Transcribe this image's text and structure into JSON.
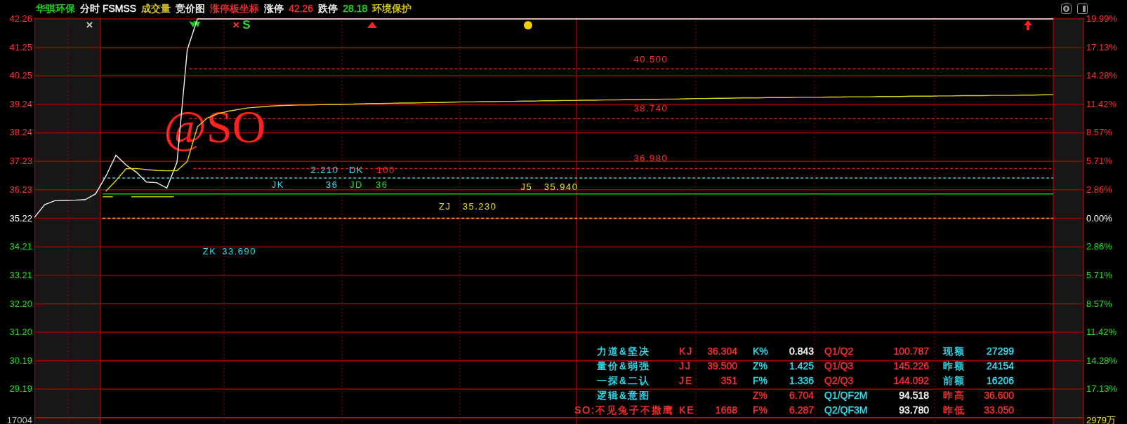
{
  "header": {
    "items": [
      {
        "text": "华骐环保",
        "color": "#20e020"
      },
      {
        "text": "分时 FSMSS",
        "color": "#ffffff"
      },
      {
        "text": "成交量",
        "color": "#e0d020"
      },
      {
        "text": "竞价图",
        "color": "#ffffff"
      },
      {
        "text": "涨停板坐标",
        "color": "#ff3030"
      },
      {
        "text": "涨停",
        "color": "#ffffff"
      },
      {
        "text": "42.26",
        "color": "#ff3030"
      },
      {
        "text": "跌停",
        "color": "#ffffff"
      },
      {
        "text": "28.18",
        "color": "#20e020"
      },
      {
        "text": "环境保护",
        "color": "#e0d020"
      }
    ]
  },
  "chart": {
    "chart_data": {
      "type": "line",
      "ylim": [
        28.18,
        42.26
      ],
      "grid": true,
      "ref_lines": [
        {
          "axis": "y",
          "value": 40.5,
          "color": "#d02020"
        },
        {
          "axis": "y",
          "value": 38.74,
          "color": "#d02020"
        },
        {
          "axis": "y",
          "value": 36.98,
          "color": "#d02020"
        },
        {
          "axis": "y",
          "value": 36.64,
          "color": "#30d0e0"
        },
        {
          "axis": "y",
          "value": 36.08,
          "color": "#20c020"
        },
        {
          "axis": "y",
          "value": 35.22,
          "color": "#ffb000"
        }
      ],
      "categories": [
        null,
        null,
        null,
        null,
        null,
        null,
        null,
        null,
        null,
        null,
        null,
        null,
        null,
        null,
        null,
        null,
        null,
        null,
        null,
        null,
        null,
        null,
        null,
        null,
        null,
        null,
        null,
        null,
        null,
        null,
        null,
        null,
        null,
        null,
        null,
        null,
        null,
        null,
        null,
        null,
        null,
        null,
        null,
        null,
        null,
        null,
        null,
        null,
        null,
        null,
        null,
        null,
        null,
        null,
        null,
        null,
        null,
        null,
        null,
        null,
        null,
        null,
        null,
        null,
        null,
        null,
        null,
        null,
        null,
        null,
        null,
        null,
        null,
        null,
        null,
        null,
        null,
        null,
        null,
        null,
        null,
        null,
        null,
        null,
        null,
        null,
        null,
        null,
        null,
        null,
        null,
        null,
        null,
        null,
        null,
        null,
        null,
        null,
        null,
        null,
        null
      ],
      "series": [
        {
          "color": "#f0f0f0",
          "values": [
            35.25,
            35.7,
            35.84,
            35.85,
            35.86,
            35.88,
            36.08,
            36.7,
            37.45,
            37.1,
            36.85,
            36.5,
            36.48,
            36.29,
            37.2,
            41.17,
            42.26,
            42.26,
            42.26,
            42.26,
            42.26,
            42.26,
            42.26,
            42.26,
            42.26,
            42.26,
            42.26,
            42.26,
            42.26,
            42.26,
            42.26,
            42.26,
            42.26,
            42.26,
            42.26,
            42.26,
            42.26,
            42.26,
            42.26,
            42.26,
            42.26,
            42.26,
            42.26,
            42.26,
            42.26,
            42.26,
            42.26,
            42.26,
            42.26,
            42.26,
            42.26,
            42.26,
            42.26,
            42.26,
            42.26,
            42.26,
            42.26,
            42.26,
            42.26,
            42.26,
            42.26,
            42.26,
            42.26,
            42.26,
            42.26,
            42.26,
            42.26,
            42.26,
            42.26,
            42.26,
            42.26,
            42.26,
            42.26,
            42.26,
            42.26,
            42.26,
            42.26,
            42.26,
            42.26,
            42.26,
            42.26,
            42.26,
            42.26,
            42.26,
            42.26,
            42.26,
            42.26,
            42.26,
            42.26,
            42.26,
            42.26,
            42.26,
            42.26,
            42.26,
            42.26,
            42.26,
            42.26,
            42.26,
            42.26,
            42.26,
            42.26
          ]
        },
        {
          "color": "#e0d020",
          "values": [
            null,
            null,
            null,
            null,
            null,
            null,
            null,
            36.17,
            36.55,
            36.97,
            36.98,
            36.94,
            36.91,
            36.9,
            36.9,
            37.23,
            38.45,
            38.77,
            38.91,
            39.0,
            39.06,
            39.12,
            39.15,
            39.18,
            39.2,
            39.21,
            39.22,
            39.22,
            39.23,
            39.24,
            39.24,
            39.25,
            39.26,
            39.27,
            39.27,
            39.28,
            39.29,
            39.29,
            39.3,
            39.31,
            39.31,
            39.32,
            39.33,
            39.33,
            39.34,
            39.34,
            39.35,
            39.35,
            39.36,
            39.36,
            39.37,
            39.37,
            39.38,
            39.38,
            39.39,
            39.39,
            39.4,
            39.4,
            39.41,
            39.41,
            39.42,
            39.42,
            39.43,
            39.43,
            39.44,
            39.45,
            39.45,
            39.46,
            39.46,
            39.47,
            39.47,
            39.47,
            39.48,
            39.48,
            39.48,
            39.49,
            39.49,
            39.49,
            39.5,
            39.5,
            39.51,
            39.51,
            39.51,
            39.52,
            39.52,
            39.52,
            39.53,
            39.53,
            39.53,
            39.54,
            39.54,
            39.55,
            39.55,
            39.55,
            39.56,
            39.56,
            39.56,
            39.57,
            39.57,
            39.58,
            39.59
          ]
        }
      ],
      "yticks": [
        {
          "value": 42.26,
          "label": "42.26"
        },
        {
          "value": 41.25,
          "label": "41.25"
        },
        {
          "value": 40.25,
          "label": "40.25"
        },
        {
          "value": 39.24,
          "label": "39.24"
        },
        {
          "value": 38.24,
          "label": "38.24"
        },
        {
          "value": 37.23,
          "label": "37.23"
        },
        {
          "value": 36.23,
          "label": "36.23"
        },
        {
          "value": 35.22,
          "label": "35.22"
        },
        {
          "value": 34.21,
          "label": "34.21"
        },
        {
          "value": 33.21,
          "label": "33.21"
        },
        {
          "value": 32.2,
          "label": "32.20"
        },
        {
          "value": 31.2,
          "label": "31.20"
        },
        {
          "value": 30.19,
          "label": "30.19"
        },
        {
          "value": 29.19,
          "label": "29.19"
        }
      ]
    },
    "chart_labels": [
      {
        "text": "×",
        "color": "#c8c8c8",
        "kind": "mark"
      },
      {
        "text": "×",
        "color": "#ff3030",
        "kind": "mark"
      },
      {
        "text": "S",
        "color": "#20e020",
        "kind": "mark"
      },
      {
        "text": "40.500",
        "color": "#ff3030",
        "kind": "small"
      },
      {
        "text": "38.740",
        "color": "#ff3030",
        "kind": "small"
      },
      {
        "text": "@SO",
        "color": "#ff2020",
        "kind": "large"
      },
      {
        "text": "36.980",
        "color": "#ff3030",
        "kind": "small"
      },
      {
        "text": "2.210",
        "color": "#30e0f0",
        "kind": "small"
      },
      {
        "text": "DK",
        "color": "#30e0f0",
        "kind": "small"
      },
      {
        "text": "100",
        "color": "#ff3030",
        "kind": "small"
      },
      {
        "text": "JK",
        "color": "#30e0f0",
        "kind": "small"
      },
      {
        "text": "36",
        "color": "#30e0f0",
        "kind": "small"
      },
      {
        "text": "JD",
        "color": "#20e020",
        "kind": "small"
      },
      {
        "text": "36",
        "color": "#20e020",
        "kind": "small"
      },
      {
        "text": "J5",
        "color": "#f0e020",
        "kind": "small"
      },
      {
        "text": "35.940",
        "color": "#f0e020",
        "kind": "small"
      },
      {
        "text": "ZJ",
        "color": "#f0e020",
        "kind": "small"
      },
      {
        "text": "35.230",
        "color": "#f0e020",
        "kind": "small"
      },
      {
        "text": "ZK",
        "color": "#30e0f0",
        "kind": "small"
      },
      {
        "text": "33.690",
        "color": "#30e0f0",
        "kind": "small"
      }
    ],
    "right_axis": [
      {
        "text": "19.99%",
        "color": "#ff3030"
      },
      {
        "text": "17.13%",
        "color": "#ff3030"
      },
      {
        "text": "14.28%",
        "color": "#ff3030"
      },
      {
        "text": "11.42%",
        "color": "#ff3030"
      },
      {
        "text": "8.57%",
        "color": "#ff3030"
      },
      {
        "text": "5.71%",
        "color": "#ff3030"
      },
      {
        "text": "2.86%",
        "color": "#ff3030"
      },
      {
        "text": "0.00%",
        "color": "#ffffff"
      },
      {
        "text": "2.86%",
        "color": "#20e020"
      },
      {
        "text": "5.71%",
        "color": "#20e020"
      },
      {
        "text": "8.57%",
        "color": "#20e020"
      },
      {
        "text": "11.42%",
        "color": "#20e020"
      },
      {
        "text": "14.28%",
        "color": "#20e020"
      },
      {
        "text": "17.13%",
        "color": "#20e020"
      }
    ],
    "volume_labels": {
      "left": {
        "text": "17004",
        "color": "#c0c0c0"
      },
      "right": {
        "text": "2979万",
        "color": "#f0e020"
      }
    },
    "indicator_table": {
      "rows": [
        {
          "cells": [
            {
              "text": "力道&坚决",
              "color": "#30e0f0"
            },
            {
              "text": "KJ",
              "color": "#ff3030"
            },
            {
              "text": "36.304",
              "color": "#ff3030"
            },
            {
              "text": "K%",
              "color": "#30e0f0"
            },
            {
              "text": "0.843",
              "color": "#ffffff"
            },
            {
              "text": "Q1/Q2",
              "color": "#ff3030"
            },
            {
              "text": "100.787",
              "color": "#ff3030"
            },
            {
              "text": "现额",
              "color": "#30e0f0"
            },
            {
              "text": "27299",
              "color": "#30e0f0"
            }
          ]
        },
        {
          "cells": [
            {
              "text": "量价&弱强",
              "color": "#30e0f0"
            },
            {
              "text": "JJ",
              "color": "#ff3030"
            },
            {
              "text": "39.500",
              "color": "#ff3030"
            },
            {
              "text": "Z%",
              "color": "#30e0f0"
            },
            {
              "text": "1.425",
              "color": "#30e0f0"
            },
            {
              "text": "Q1/Q3",
              "color": "#ff3030"
            },
            {
              "text": "145.226",
              "color": "#ff3030"
            },
            {
              "text": "昨额",
              "color": "#30e0f0"
            },
            {
              "text": "24154",
              "color": "#30e0f0"
            }
          ]
        },
        {
          "cells": [
            {
              "text": "一探&二认",
              "color": "#30e0f0"
            },
            {
              "text": "JE",
              "color": "#ff3030"
            },
            {
              "text": "351",
              "color": "#ff3030"
            },
            {
              "text": "F%",
              "color": "#30e0f0"
            },
            {
              "text": "1.336",
              "color": "#30e0f0"
            },
            {
              "text": "Q2/Q3",
              "color": "#ff3030"
            },
            {
              "text": "144.092",
              "color": "#ff3030"
            },
            {
              "text": "前额",
              "color": "#30e0f0"
            },
            {
              "text": "16206",
              "color": "#30e0f0"
            }
          ]
        },
        {
          "cells": [
            {
              "text": "逻辑&意图",
              "color": "#30e0f0"
            },
            null,
            null,
            {
              "text": "Z%",
              "color": "#ff3030"
            },
            {
              "text": "6.704",
              "color": "#ff3030"
            },
            {
              "text": "Q1/QF2M",
              "color": "#30e0f0"
            },
            {
              "text": "94.518",
              "color": "#ffffff"
            },
            {
              "text": "昨高",
              "color": "#ff3030"
            },
            {
              "text": "36.600",
              "color": "#ff3030"
            }
          ]
        },
        {
          "cells": [
            {
              "text": "SO:不见兔子不撒鹰",
              "color": "#ff3030"
            },
            {
              "text": "KE",
              "color": "#ff3030"
            },
            {
              "text": "1668",
              "color": "#ff3030"
            },
            {
              "text": "F%",
              "color": "#ff3030"
            },
            {
              "text": "6.287",
              "color": "#ff3030"
            },
            {
              "text": "Q2/QF3M",
              "color": "#30e0f0"
            },
            {
              "text": "93.780",
              "color": "#ffffff"
            },
            {
              "text": "昨低",
              "color": "#ff3030"
            },
            {
              "text": "33.050",
              "color": "#ff3030"
            }
          ]
        }
      ]
    }
  }
}
